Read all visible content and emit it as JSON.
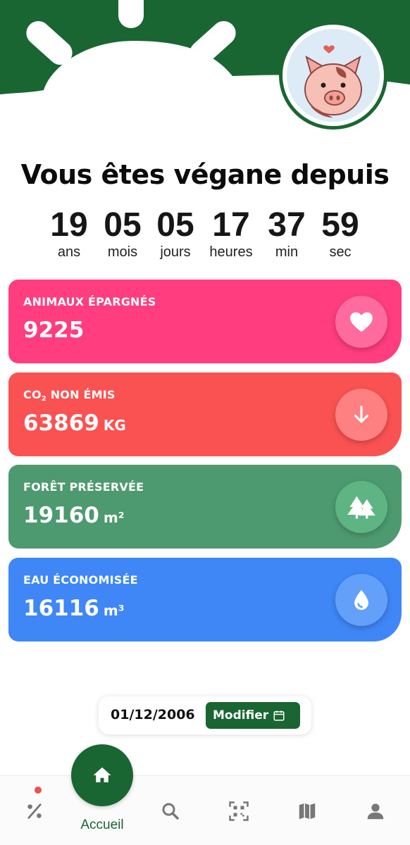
{
  "header": {
    "avatar_icon": "pig-icon",
    "colors": {
      "brand_green": "#1a6632"
    }
  },
  "title": "Vous êtes végane depuis",
  "counters": [
    {
      "value": "19",
      "unit": "ans"
    },
    {
      "value": "05",
      "unit": "mois"
    },
    {
      "value": "05",
      "unit": "jours"
    },
    {
      "value": "17",
      "unit": "heures"
    },
    {
      "value": "37",
      "unit": "min"
    },
    {
      "value": "59",
      "unit": "sec"
    }
  ],
  "stats": [
    {
      "label": "ANIMAUX ÉPARGNÉS",
      "value": "9225",
      "unit": "",
      "icon": "heart-icon",
      "color": "#ff3d7f",
      "icon_bg": "#ff6b9d"
    },
    {
      "label_prefix": "CO",
      "label_sub": "2",
      "label_suffix": " NON ÉMIS",
      "value": "63869",
      "unit": "KG",
      "icon": "arrow-down-icon",
      "color": "#fa5252",
      "icon_bg": "#ff8080"
    },
    {
      "label": "FORÊT PRÉSERVÉE",
      "value": "19160",
      "unit": "m²",
      "icon": "forest-icon",
      "color": "#4e9a70",
      "icon_bg": "#5fb484"
    },
    {
      "label": "EAU ÉCONOMISÉE",
      "value": "16116",
      "unit": "m³",
      "icon": "water-drop-icon",
      "color": "#3f86f6",
      "icon_bg": "#62a0fa"
    }
  ],
  "date_picker": {
    "date": "01/12/2006",
    "button_label": "Modifier"
  },
  "bottom_nav": {
    "home_label": "Accueil",
    "items": [
      "percent-icon",
      "home-icon",
      "search-icon",
      "qr-code-icon",
      "map-icon",
      "profile-icon"
    ]
  }
}
